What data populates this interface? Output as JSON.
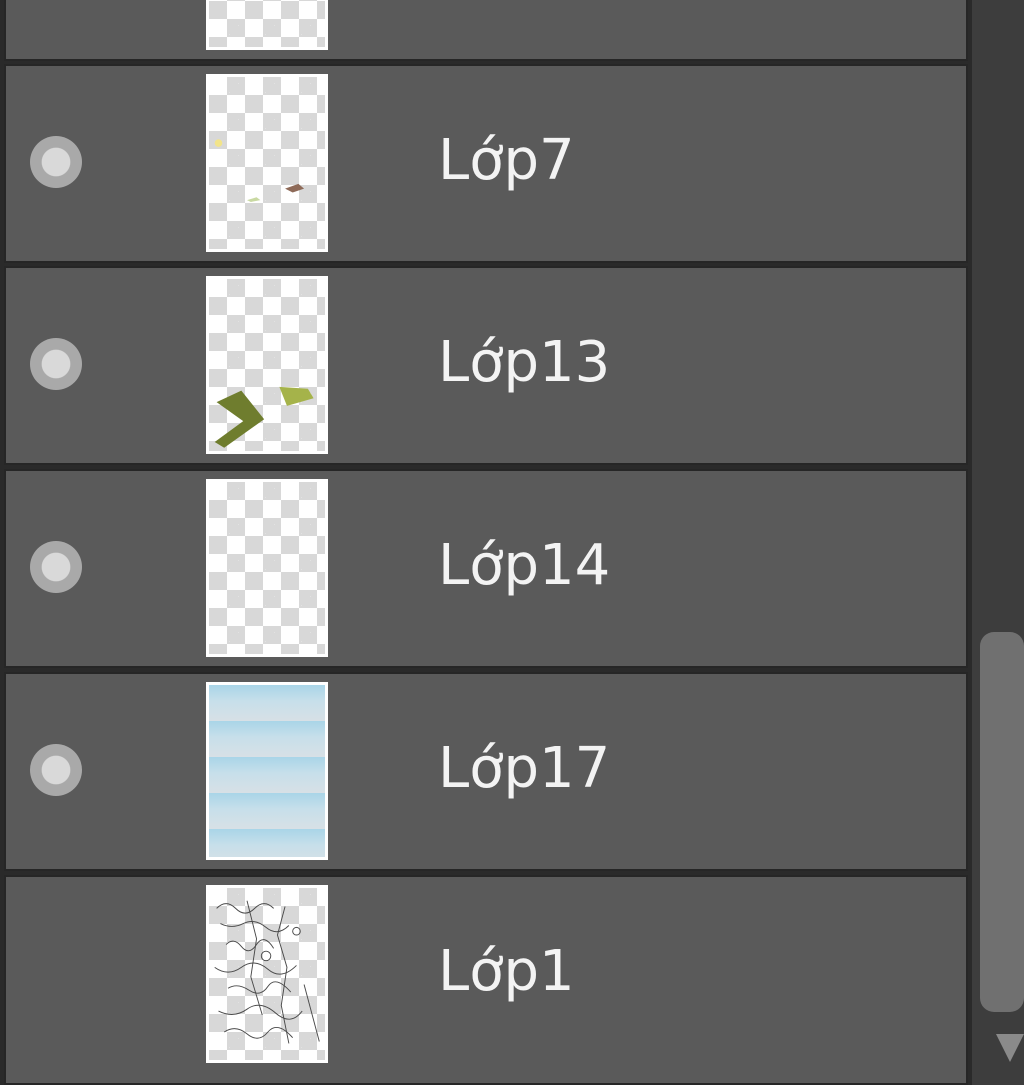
{
  "layers": [
    {
      "name": "",
      "visible": false,
      "thumb": "transparent"
    },
    {
      "name": "Lớp7",
      "visible": true,
      "thumb": "sparse-marks"
    },
    {
      "name": "Lớp13",
      "visible": true,
      "thumb": "green-leaves"
    },
    {
      "name": "Lớp14",
      "visible": true,
      "thumb": "transparent"
    },
    {
      "name": "Lớp17",
      "visible": true,
      "thumb": "sky"
    },
    {
      "name": "Lớp1",
      "visible": false,
      "thumb": "sketch"
    }
  ],
  "colors": {
    "row_bg": "#5a5a5a",
    "row_border": "#262626",
    "text": "#f3f3f3",
    "scroll_thumb": "#707070"
  },
  "icons": {
    "visibility": "eye-dot-icon",
    "scroll_down": "arrow-down-icon"
  }
}
